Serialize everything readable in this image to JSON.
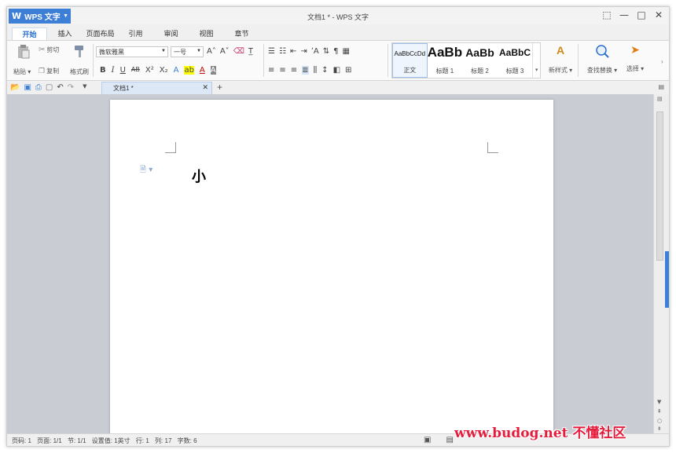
{
  "app": {
    "name": "WPS 文字",
    "window_title": "文档1 * - WPS 文字"
  },
  "window_controls": [
    "⬚",
    "—",
    "□",
    "✕"
  ],
  "menu_tabs": [
    "开始",
    "插入",
    "页面布局",
    "引用",
    "审阅",
    "视图",
    "章节"
  ],
  "ribbon": {
    "paste_label": "粘贴",
    "cut_label": "剪切",
    "copy_label": "复制",
    "format_painter_label": "格式刷",
    "font_name": "微软雅黑",
    "font_size": "一号",
    "styles": [
      {
        "preview": "AaBbCcDd",
        "name": "正文"
      },
      {
        "preview": "AaBb",
        "name": "标题 1"
      },
      {
        "preview": "AaBb",
        "name": "标题 2"
      },
      {
        "preview": "AaBbC",
        "name": "标题 3"
      }
    ],
    "new_style_label": "新样式",
    "find_replace_label": "查找替换",
    "select_label": "选择"
  },
  "document_tab": {
    "label": "文档1 *"
  },
  "document": {
    "text": "小"
  },
  "status_bar": {
    "page": "页码: 1",
    "pages": "页面: 1/1",
    "section": "节: 1/1",
    "setting": "设置值: 1英寸",
    "row": "行: 1",
    "column": "列: 17",
    "word_count": "字数: 6"
  },
  "watermark": "www.budog.net 不懂社区",
  "colors": {
    "accent": "#3d7fd6",
    "page_bg": "#c9cdd3",
    "watermark": "#e61c3d"
  }
}
